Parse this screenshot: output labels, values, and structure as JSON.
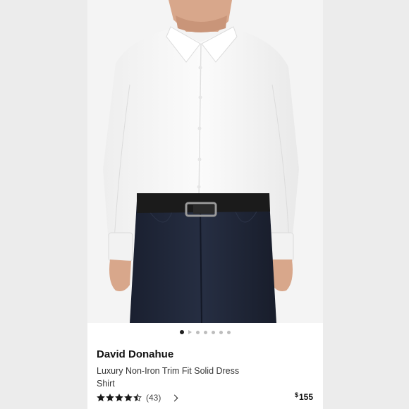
{
  "product": {
    "brand": "David Donahue",
    "name": "Luxury Non-Iron Trim Fit Solid Dress Shirt",
    "rating_stars": 4.5,
    "review_count": "(43)",
    "price_symbol": "$",
    "price_value": "155"
  },
  "carousel": {
    "total_dots": 7,
    "active_index": 0
  },
  "icons": {
    "next": "chevron-right-icon",
    "star": "star-icon"
  },
  "colors": {
    "shirt": "#f7f7f7",
    "pants": "#1e2536",
    "belt": "#1a1a1a",
    "skin": "#d9a98e",
    "background": "#ececec"
  }
}
